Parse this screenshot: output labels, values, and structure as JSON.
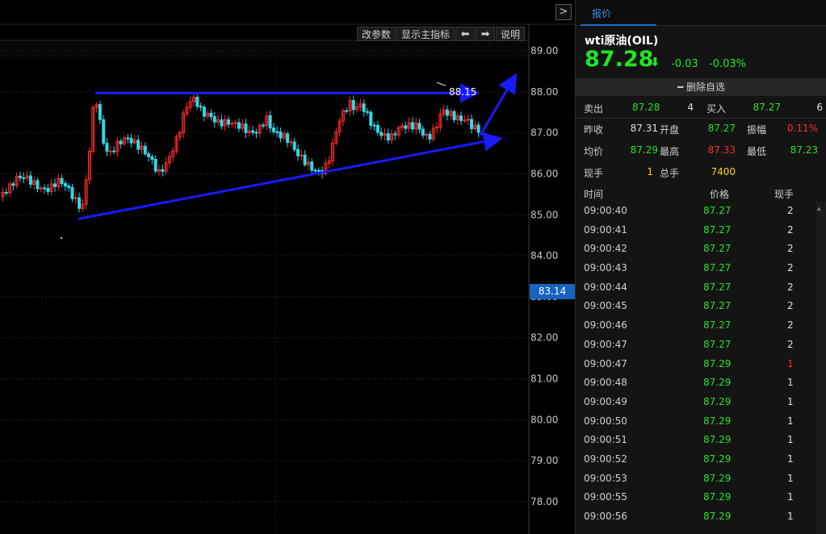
{
  "toolbar": {
    "change_params": "改参数",
    "show_main_indicator": "显示主指标",
    "arrow_left": "⬅",
    "arrow_right": "➡",
    "explain": "说明"
  },
  "chart_data": {
    "type": "candlestick",
    "y_ticks": [
      "89.00",
      "88.00",
      "87.00",
      "86.00",
      "85.00",
      "84.00",
      "83.00",
      "82.00",
      "81.00",
      "80.00",
      "79.00",
      "78.00"
    ],
    "ylim": [
      77.8,
      89.15
    ],
    "current_price_tag": "83.14",
    "high_annotation": "88.15",
    "high_value": 88.15,
    "colors": {
      "up": "#ff2b2b",
      "down": "#33d7e8",
      "trend": "#1a1aff"
    }
  },
  "panel": {
    "tab": "报价",
    "instrument": "wti原油(OIL)",
    "last_price": "87.28",
    "change": "-0.03",
    "change_pct": "-0.03%",
    "remove_favorite": "━ 删除自选",
    "ask_label": "卖出",
    "ask_price": "87.28",
    "ask_qty": "4",
    "bid_label": "买入",
    "bid_price": "87.27",
    "bid_qty": "6",
    "prev_close_label": "昨收",
    "prev_close": "87.31",
    "open_label": "开盘",
    "open": "87.27",
    "amplitude_label": "振幅",
    "amplitude": "0.11%",
    "avg_label": "均价",
    "avg": "87.29",
    "high_label": "最高",
    "high": "87.33",
    "low_label": "最低",
    "low": "87.23",
    "current_vol_label": "现手",
    "current_vol": "1",
    "total_vol_label": "总手",
    "total_vol": "7400",
    "ticks_header": {
      "time": "时间",
      "price": "价格",
      "qty": "现手"
    },
    "ticks": [
      {
        "time": "09:00:40",
        "price": "87.27",
        "qty": "2",
        "color": "white"
      },
      {
        "time": "09:00:41",
        "price": "87.27",
        "qty": "2",
        "color": "white"
      },
      {
        "time": "09:00:42",
        "price": "87.27",
        "qty": "2",
        "color": "white"
      },
      {
        "time": "09:00:43",
        "price": "87.27",
        "qty": "2",
        "color": "white"
      },
      {
        "time": "09:00:44",
        "price": "87.27",
        "qty": "2",
        "color": "white"
      },
      {
        "time": "09:00:45",
        "price": "87.27",
        "qty": "2",
        "color": "white"
      },
      {
        "time": "09:00:46",
        "price": "87.27",
        "qty": "2",
        "color": "white"
      },
      {
        "time": "09:00:47",
        "price": "87.27",
        "qty": "2",
        "color": "white"
      },
      {
        "time": "09:00:47",
        "price": "87.29",
        "qty": "1",
        "color": "red"
      },
      {
        "time": "09:00:48",
        "price": "87.29",
        "qty": "1",
        "color": "white"
      },
      {
        "time": "09:00:49",
        "price": "87.29",
        "qty": "1",
        "color": "white"
      },
      {
        "time": "09:00:50",
        "price": "87.29",
        "qty": "1",
        "color": "white"
      },
      {
        "time": "09:00:51",
        "price": "87.29",
        "qty": "1",
        "color": "white"
      },
      {
        "time": "09:00:52",
        "price": "87.29",
        "qty": "1",
        "color": "white"
      },
      {
        "time": "09:00:53",
        "price": "87.29",
        "qty": "1",
        "color": "white"
      },
      {
        "time": "09:00:55",
        "price": "87.29",
        "qty": "1",
        "color": "white"
      },
      {
        "time": "09:00:56",
        "price": "87.29",
        "qty": "1",
        "color": "white"
      }
    ]
  }
}
